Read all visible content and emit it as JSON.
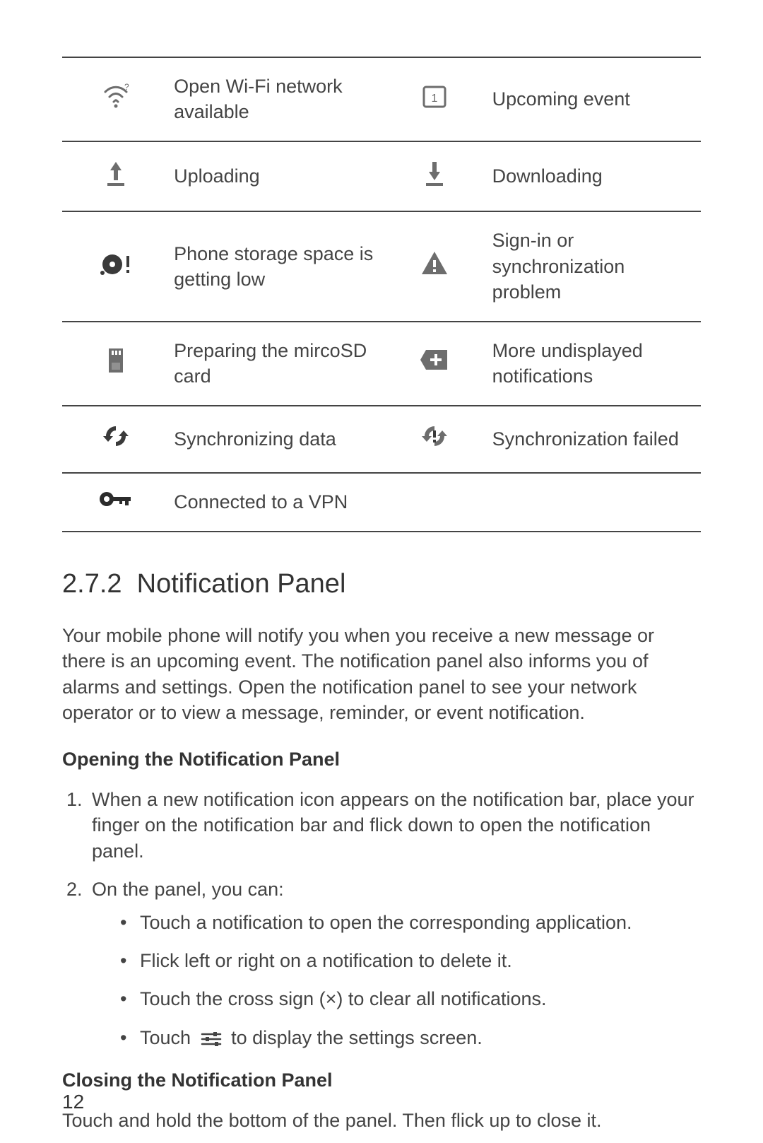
{
  "table": {
    "rows": [
      {
        "left_icon": "wifi-open-icon",
        "left": "Open Wi-Fi network available",
        "right_icon": "calendar-icon",
        "right": "Upcoming event"
      },
      {
        "left_icon": "upload-icon",
        "left": "Uploading",
        "right_icon": "download-icon",
        "right": "Downloading"
      },
      {
        "left_icon": "storage-low-icon",
        "left": "Phone storage space is getting low",
        "right_icon": "warning-icon",
        "right": "Sign-in or synchronization problem"
      },
      {
        "left_icon": "sd-prepare-icon",
        "left": "Preparing the mircoSD card",
        "right_icon": "more-notif-icon",
        "right": "More undisplayed notifications"
      },
      {
        "left_icon": "sync-icon",
        "left": "Synchronizing data",
        "right_icon": "sync-fail-icon",
        "right": "Synchronization failed"
      },
      {
        "left_icon": "vpn-key-icon",
        "left": "Connected to a VPN",
        "right_icon": "",
        "right": ""
      }
    ]
  },
  "section": {
    "number": "2.7.2",
    "title": "Notification Panel",
    "intro": "Your mobile phone will notify you when you receive a new message or there is an upcoming event. The notification panel also informs you of alarms and settings. Open the notification panel to see your network operator or to view a message, reminder, or event notification."
  },
  "opening": {
    "heading": "Opening the Notification Panel",
    "step1": "When a new notification icon appears on the notification bar, place your finger on the notification bar and flick down to open the notification panel.",
    "step2_lead": "On the panel, you can:",
    "bullets": [
      "Touch a notification to open the corresponding application.",
      "Flick left or right on a notification to delete it.",
      "Touch the cross sign (×) to clear all notifications."
    ],
    "bullet4_before": "Touch ",
    "bullet4_after": " to display the settings screen."
  },
  "closing": {
    "heading": "Closing the Notification Panel",
    "text": "Touch and hold the bottom of the panel. Then flick up to close it."
  },
  "page_number": "12"
}
